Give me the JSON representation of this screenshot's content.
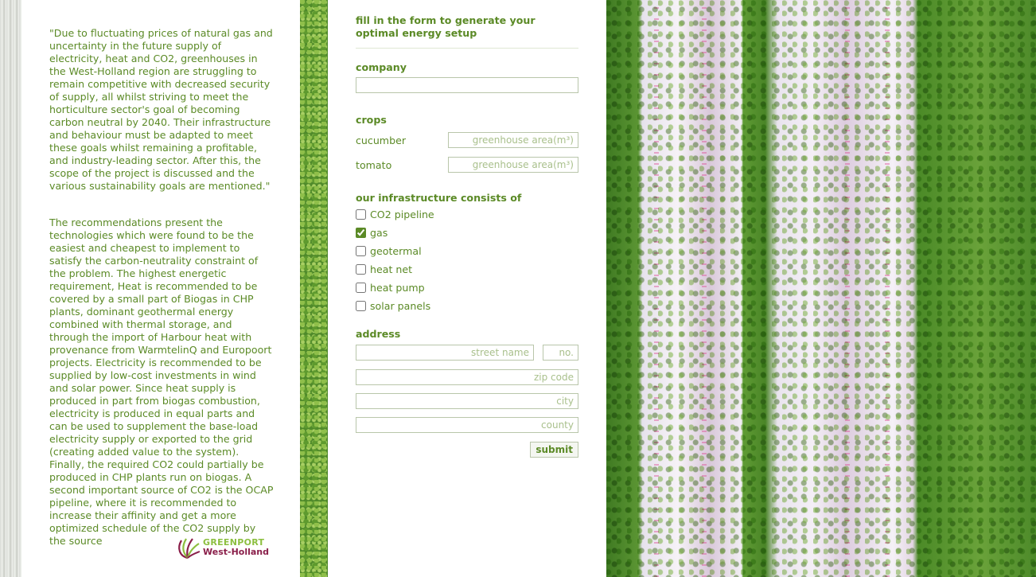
{
  "intro": {
    "paragraph1": "\"Due to fluctuating prices of natural gas and uncertainty in the future supply of electricity, heat and CO2, greenhouses in the West-Holland region are struggling to remain competitive with decreased security of supply, all whilst striving to meet the horticulture sector's goal of becoming carbon neutral by 2040. Their infrastructure and behaviour must be adapted to meet these goals whilst remaining a profitable, and industry-leading sector. After this, the scope of the project is discussed and the various sustainability goals are mentioned.\"",
    "paragraph2": "The recommendations present the technologies which were found to be the easiest and cheapest to implement to satisfy the carbon-neutrality constraint of the problem. The highest energetic requirement, Heat is recommended to be covered by a small part of Biogas in CHP plants, dominant geothermal energy combined with thermal storage, and through the import of Harbour heat with provenance from WarmtelinQ and Europoort projects. Electricity is recommended to be supplied by low-cost investments in wind and solar power. Since heat supply is produced in part from biogas combustion, electricity is produced in equal parts and can be used to supplement the base-load electricity supply or exported to the grid (creating added value to the system). Finally, the required CO2 could partially be produced in CHP plants run on biogas. A second important source of CO2 is the OCAP pipeline, where it is recommended to increase their affinity and get a more optimized schedule of the CO2 supply by the source"
  },
  "logo": {
    "line1": "GREENPORT",
    "line2": "West-Holland"
  },
  "form": {
    "title": "fill in the form to generate your optimal energy setup",
    "company_label": "company",
    "company_value": "",
    "crops_label": "crops",
    "crops": [
      {
        "name": "cucumber",
        "placeholder": "greenhouse area(m³)"
      },
      {
        "name": "tomato",
        "placeholder": "greenhouse area(m³)"
      }
    ],
    "infrastructure_label": "our infrastructure consists of",
    "infrastructure": [
      {
        "label": "CO2 pipeline",
        "checked": false
      },
      {
        "label": "gas",
        "checked": true
      },
      {
        "label": "geotermal",
        "checked": false
      },
      {
        "label": "heat net",
        "checked": false
      },
      {
        "label": "heat pump",
        "checked": false
      },
      {
        "label": "solar panels",
        "checked": false
      }
    ],
    "address_label": "address",
    "street_placeholder": "street name",
    "number_placeholder": "no.",
    "zip_placeholder": "zip code",
    "city_placeholder": "city",
    "county_placeholder": "county",
    "submit_label": "submit"
  },
  "colors": {
    "text_green": "#5b8a26",
    "logo_green": "#8cbf3f",
    "logo_purple": "#8a1f4a"
  }
}
